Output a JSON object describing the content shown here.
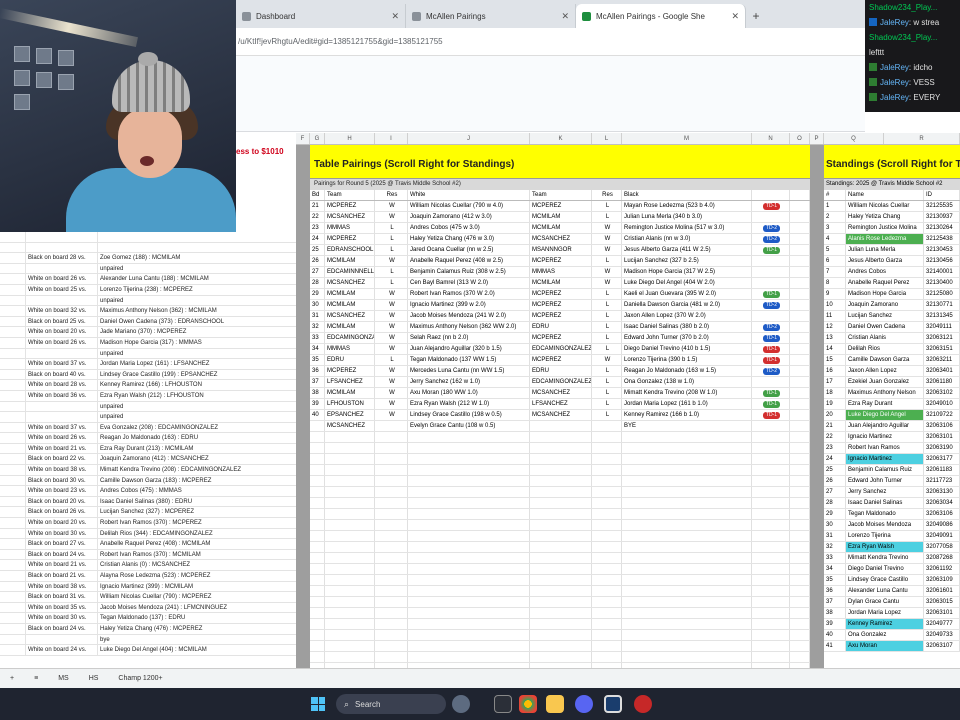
{
  "browser": {
    "tabs": [
      {
        "title": "Dashboard",
        "active": false
      },
      {
        "title": "McAllen Pairings",
        "active": false
      },
      {
        "title": "McAllen Pairings - Google She",
        "active": true
      }
    ],
    "url": "/u/KtIf!jevRhgtuA/edit#gid=1385121755&gid=1385121755"
  },
  "sheet": {
    "red_title": "ess to $1010",
    "column_headers": [
      "F",
      "G",
      "H",
      "I",
      "J",
      "K",
      "L",
      "M",
      "N",
      "O",
      "P",
      "Q",
      "R"
    ],
    "pairings": {
      "title": "Table Pairings (Scroll Right for Standings)",
      "subtitle": "Pairings for Round 5 (2025 @ Travis Middle School #2)",
      "headers": {
        "bd": "Bd",
        "team1": "Team",
        "res1": "Res",
        "white": "White",
        "team2": "Team",
        "res2": "Res",
        "black": "Black"
      },
      "rows": [
        {
          "bd": "21",
          "team1": "MCPEREZ",
          "res1": "W",
          "white": "William Nicolas Cuellar (790 w 4.0)",
          "team2": "MCPEREZ",
          "res2": "L",
          "black": "Mayan Rose Ledezma (523 b 4.0)",
          "tag": "TD-1",
          "tag_color": "red"
        },
        {
          "bd": "22",
          "team1": "MCSANCHEZ",
          "res1": "W",
          "white": "Joaquin Zamorano (412 w 3.0)",
          "team2": "MCMILAM",
          "res2": "L",
          "black": "Julian Luna Merla (340 b 3.0)",
          "tag": "",
          "tag_color": ""
        },
        {
          "bd": "23",
          "team1": "MMMAS",
          "res1": "L",
          "white": "Andres Cobos (475 w 3.0)",
          "team2": "MCMILAM",
          "res2": "W",
          "black": "Remington Justice Molina (517 w 3.0)",
          "tag": "TD-2",
          "tag_color": "blue"
        },
        {
          "bd": "24",
          "team1": "MCPEREZ",
          "res1": "L",
          "white": "Haley Yetiza Chang (476 w 3.0)",
          "team2": "MCSANCHEZ",
          "res2": "W",
          "black": "Cristian Alanis (nn w 3.0)",
          "tag": "TD-2",
          "tag_color": "blue"
        },
        {
          "bd": "25",
          "team1": "EDRANSCHOOL",
          "res1": "L",
          "white": "Jared Ocana Cuellar (nn w 2.5)",
          "team2": "MSANNNGOR",
          "res2": "W",
          "black": "Jesus Alberto Garza (411 W 2.5)",
          "tag": "TD-1",
          "tag_color": "green"
        },
        {
          "bd": "26",
          "team1": "MCMILAM",
          "res1": "W",
          "white": "Anabelle Raquel Perez (408 w 2.5)",
          "team2": "MCPEREZ",
          "res2": "L",
          "black": "Lucijan Sanchez (327 b 2.5)",
          "tag": "",
          "tag_color": ""
        },
        {
          "bd": "27",
          "team1": "EDCAMINNNELL",
          "res1": "L",
          "white": "Benjamin Calamus Ruiz (308 w 2.5)",
          "team2": "MMMAS",
          "res2": "W",
          "black": "Madison Hope Garcia (317 W 2.5)",
          "tag": "",
          "tag_color": ""
        },
        {
          "bd": "28",
          "team1": "MCSANCHEZ",
          "res1": "L",
          "white": "Cen Bayl Bamrel (313 W 2.0)",
          "team2": "MCMILAM",
          "res2": "W",
          "black": "Luke Diego Del Angel (404 W 2.0)",
          "tag": "",
          "tag_color": ""
        },
        {
          "bd": "29",
          "team1": "MCMILAM",
          "res1": "W",
          "white": "Robert Ivan Ramos (370 W 2.0)",
          "team2": "MCPEREZ",
          "res2": "L",
          "black": "Kaeli el Juan Guevara (395 W 2.0)",
          "tag": "TD-1",
          "tag_color": "green"
        },
        {
          "bd": "30",
          "team1": "MCMILAM",
          "res1": "W",
          "white": "Ignacio Martinez (399 w 2.0)",
          "team2": "MCPEREZ",
          "res2": "L",
          "black": "Daniella Dawson Garcia (481 w 2.0)",
          "tag": "TD-2",
          "tag_color": "blue"
        },
        {
          "bd": "31",
          "team1": "MCSANCHEZ",
          "res1": "W",
          "white": "Jacob Moises Mendoza (241 W 2.0)",
          "team2": "MCPEREZ",
          "res2": "L",
          "black": "Jaxon Allen Lopez (370 W 2.0)",
          "tag": "",
          "tag_color": ""
        },
        {
          "bd": "32",
          "team1": "MCMILAM",
          "res1": "W",
          "white": "Maximus Anthony Nelson (362 WW 2.0)",
          "team2": "EDRU",
          "res2": "L",
          "black": "Isaac Daniel Salinas (380 b 2.0)",
          "tag": "TD-2",
          "tag_color": "blue"
        },
        {
          "bd": "33",
          "team1": "EDCAMINGONZALEZ",
          "res1": "W",
          "white": "Selah Raez (nn b 2.0)",
          "team2": "MCPEREZ",
          "res2": "L",
          "black": "Edward John Turner (370 b 2.0)",
          "tag": "TD-1",
          "tag_color": "blue"
        },
        {
          "bd": "34",
          "team1": "MMMAS",
          "res1": "W",
          "white": "Juan Alejandro Aguillar (320 b 1.5)",
          "team2": "EDCAMINGONZALEZ",
          "res2": "L",
          "black": "Diego Daniel Trevino (410 b 1.5)",
          "tag": "TD-1",
          "tag_color": "red"
        },
        {
          "bd": "35",
          "team1": "EDRU",
          "res1": "L",
          "white": "Tegan Maldonado (137 WW 1.5)",
          "team2": "MCPEREZ",
          "res2": "W",
          "black": "Lorenzo Tijerina (390 b 1.5)",
          "tag": "TD-1",
          "tag_color": "red"
        },
        {
          "bd": "36",
          "team1": "MCPEREZ",
          "res1": "W",
          "white": "Mercedes Luna Cantu (nn WW 1.5)",
          "team2": "EDRU",
          "res2": "L",
          "black": "Reagan Jo Maldonado (163 w 1.5)",
          "tag": "TD-2",
          "tag_color": "blue"
        },
        {
          "bd": "37",
          "team1": "LFSANCHEZ",
          "res1": "W",
          "white": "Jerry Sanchez (162 w 1.0)",
          "team2": "EDCAMINGONZALEZ",
          "res2": "L",
          "black": "Ona Gonzalez (138 w 1.0)",
          "tag": "",
          "tag_color": ""
        },
        {
          "bd": "38",
          "team1": "MCMILAM",
          "res1": "W",
          "white": "Axu Moran (180 WW 1.0)",
          "team2": "MCSANCHEZ",
          "res2": "L",
          "black": "Mimatt Kendra Trevino (208 W 1.0)",
          "tag": "TD-1",
          "tag_color": "green"
        },
        {
          "bd": "39",
          "team1": "LFHOUSTON",
          "res1": "W",
          "white": "Ezra Ryan Walsh (212 W 1.0)",
          "team2": "LFSANCHEZ",
          "res2": "L",
          "black": "Jordan Maria Lopez (161 b 1.0)",
          "tag": "TD-1",
          "tag_color": "green"
        },
        {
          "bd": "40",
          "team1": "EPSANCHEZ",
          "res1": "W",
          "white": "Lindsey Grace Castillo (198 w 0.5)",
          "team2": "MCSANCHEZ",
          "res2": "L",
          "black": "Kenney Ramirez (166 b 1.0)",
          "tag": "TD-1",
          "tag_color": "red"
        },
        {
          "bd": "",
          "team1": "MCSANCHEZ",
          "res1": "",
          "white": "Evelyn Grace Cantu (108 w 0.5)",
          "team2": "",
          "res2": "",
          "black": "BYE",
          "tag": "",
          "tag_color": ""
        }
      ]
    },
    "standings": {
      "title": "Standings (Scroll Right for Team",
      "subtitle": "Standings: 2025 @ Travis Middle School #2",
      "headers": {
        "rank": "#",
        "name": "Name",
        "id": "ID"
      },
      "rows": [
        {
          "rank": "1",
          "name": "William Nicolas Cuellar",
          "id": "32125535",
          "hl": ""
        },
        {
          "rank": "2",
          "name": "Haley Yetiza Chang",
          "id": "32130937",
          "hl": ""
        },
        {
          "rank": "3",
          "name": "Remington Justice Molina",
          "id": "32130264",
          "hl": ""
        },
        {
          "rank": "4",
          "name": "Alanis Rose Ledezma",
          "id": "32125438",
          "hl": "green"
        },
        {
          "rank": "5",
          "name": "Julian Luna Merla",
          "id": "32130453",
          "hl": ""
        },
        {
          "rank": "6",
          "name": "Jesus Alberto Garza",
          "id": "32130456",
          "hl": ""
        },
        {
          "rank": "7",
          "name": "Andres Cobos",
          "id": "32140001",
          "hl": ""
        },
        {
          "rank": "8",
          "name": "Anabelle Raquel Perez",
          "id": "32130400",
          "hl": ""
        },
        {
          "rank": "9",
          "name": "Madison Hope Garcia",
          "id": "32125080",
          "hl": ""
        },
        {
          "rank": "10",
          "name": "Joaquin Zamorano",
          "id": "32130771",
          "hl": ""
        },
        {
          "rank": "11",
          "name": "Lucijan Sanchez",
          "id": "32131345",
          "hl": ""
        },
        {
          "rank": "12",
          "name": "Daniel Owen Cadena",
          "id": "32049111",
          "hl": ""
        },
        {
          "rank": "13",
          "name": "Cristian Alanis",
          "id": "32063121",
          "hl": ""
        },
        {
          "rank": "14",
          "name": "Delilah Rios",
          "id": "32063151",
          "hl": ""
        },
        {
          "rank": "15",
          "name": "Camille Dawson Garza",
          "id": "32063211",
          "hl": ""
        },
        {
          "rank": "16",
          "name": "Jaxon Allen Lopez",
          "id": "32063401",
          "hl": ""
        },
        {
          "rank": "17",
          "name": "Ezekiel Juan Gonzalez",
          "id": "32061180",
          "hl": ""
        },
        {
          "rank": "18",
          "name": "Maximus Anthony Nelson",
          "id": "32063102",
          "hl": ""
        },
        {
          "rank": "19",
          "name": "Ezra Ray Durant",
          "id": "32049010",
          "hl": ""
        },
        {
          "rank": "20",
          "name": "Luke Diego Del Angel",
          "id": "32109722",
          "hl": "green"
        },
        {
          "rank": "21",
          "name": "Juan Alejandro Aguillar",
          "id": "32063106",
          "hl": ""
        },
        {
          "rank": "22",
          "name": "Ignacio Martinez",
          "id": "32063101",
          "hl": ""
        },
        {
          "rank": "23",
          "name": "Robert Ivan Ramos",
          "id": "32063190",
          "hl": ""
        },
        {
          "rank": "24",
          "name": "Ignacio Martinez",
          "id": "32063177",
          "hl": "cyan"
        },
        {
          "rank": "25",
          "name": "Benjamin Calamus Ruiz",
          "id": "32061183",
          "hl": ""
        },
        {
          "rank": "26",
          "name": "Edward John Turner",
          "id": "32117723",
          "hl": ""
        },
        {
          "rank": "27",
          "name": "Jerry Sanchez",
          "id": "32063130",
          "hl": ""
        },
        {
          "rank": "28",
          "name": "Isaac Daniel Salinas",
          "id": "32063034",
          "hl": ""
        },
        {
          "rank": "29",
          "name": "Tegan Maldonado",
          "id": "32063106",
          "hl": ""
        },
        {
          "rank": "30",
          "name": "Jacob Moises Mendoza",
          "id": "32049086",
          "hl": ""
        },
        {
          "rank": "31",
          "name": "Lorenzo Tijerina",
          "id": "32049091",
          "hl": ""
        },
        {
          "rank": "32",
          "name": "Ezra Ryan Walsh",
          "id": "32077058",
          "hl": "cyan"
        },
        {
          "rank": "33",
          "name": "Mimatt Kendra Trevino",
          "id": "32087268",
          "hl": ""
        },
        {
          "rank": "34",
          "name": "Diego Daniel Trevino",
          "id": "32061192",
          "hl": ""
        },
        {
          "rank": "35",
          "name": "Lindsey Grace Castillo",
          "id": "32063109",
          "hl": ""
        },
        {
          "rank": "36",
          "name": "Alexander Luna Cantu",
          "id": "32061601",
          "hl": ""
        },
        {
          "rank": "37",
          "name": "Dylan Grace Cantu",
          "id": "32063015",
          "hl": ""
        },
        {
          "rank": "38",
          "name": "Jordan Maria Lopez",
          "id": "32063101",
          "hl": ""
        },
        {
          "rank": "39",
          "name": "Kenney Ramirez",
          "id": "32049777",
          "hl": "cyan"
        },
        {
          "rank": "40",
          "name": "Ona Gonzalez",
          "id": "32049733",
          "hl": ""
        },
        {
          "rank": "41",
          "name": "Axu Moran",
          "id": "32063107",
          "hl": "cyan"
        }
      ]
    },
    "left_rows": [
      {
        "c0": "",
        "c1": "",
        "c2": ""
      },
      {
        "c0": "",
        "c1": "",
        "c2": ""
      },
      {
        "c0": "",
        "c1": "Black on board 28 vs.",
        "c2": "Zoe Gomez (188) : MCMILAM"
      },
      {
        "c0": "",
        "c1": "",
        "c2": "unpaired"
      },
      {
        "c0": "",
        "c1": "White on board 26 vs.",
        "c2": "Alexander Luna Cantu (188) : MCMILAM"
      },
      {
        "c0": "",
        "c1": "White on board 25 vs.",
        "c2": "Lorenzo Tijerina (238) : MCPEREZ"
      },
      {
        "c0": "",
        "c1": "",
        "c2": "unpaired"
      },
      {
        "c0": "",
        "c1": "White on board 32 vs.",
        "c2": "Maximus Anthony Nelson (362) : MCMILAM"
      },
      {
        "c0": "",
        "c1": "Black on board 25 vs.",
        "c2": "Daniel Owen Cadena (373) : EDRANSCHOOL"
      },
      {
        "c0": "",
        "c1": "White on board 20 vs.",
        "c2": "Jade Mariano (370) : MCPEREZ"
      },
      {
        "c0": "",
        "c1": "White on board 26 vs.",
        "c2": "Madison Hope Garcia (317) : MMMAS"
      },
      {
        "c0": "",
        "c1": "",
        "c2": "unpaired"
      },
      {
        "c0": "",
        "c1": "White on board 37 vs.",
        "c2": "Jordan Maria Lopez (161) : LFSANCHEZ"
      },
      {
        "c0": "",
        "c1": "Black on board 40 vs.",
        "c2": "Lindsey Grace Castillo (199) : EPSANCHEZ"
      },
      {
        "c0": "",
        "c1": "White on board 28 vs.",
        "c2": "Kenney Ramirez (166) : LFHOUSTON"
      },
      {
        "c0": "",
        "c1": "White on board 36 vs.",
        "c2": "Ezra Ryan Walsh (212) : LFHOUSTON"
      },
      {
        "c0": "",
        "c1": "",
        "c2": "unpaired"
      },
      {
        "c0": "",
        "c1": "",
        "c2": "unpaired"
      },
      {
        "c0": "",
        "c1": "White on board 37 vs.",
        "c2": "Eva Gonzalez (208) : EDCAMINGONZALEZ"
      },
      {
        "c0": "",
        "c1": "White on board 26 vs.",
        "c2": "Reagan Jo Maldonado (163) : EDRU"
      },
      {
        "c0": "",
        "c1": "White on board 21 vs.",
        "c2": "Ezra Ray Durant (213) : MCMILAM"
      },
      {
        "c0": "",
        "c1": "Black on board 22 vs.",
        "c2": "Joaquin Zamorano (412) : MCSANCHEZ"
      },
      {
        "c0": "",
        "c1": "White on board 38 vs.",
        "c2": "Mimatt Kendra Trevino (208) : EDCAMINGONZALEZ"
      },
      {
        "c0": "",
        "c1": "Black on board 30 vs.",
        "c2": "Camille Dawson Garza (183) : MCPEREZ"
      },
      {
        "c0": "",
        "c1": "White on board 23 vs.",
        "c2": "Andres Cobos (475) : MMMAS"
      },
      {
        "c0": "",
        "c1": "Black on board 20 vs.",
        "c2": "Isaac Daniel Salinas (380) : EDRU"
      },
      {
        "c0": "",
        "c1": "Black on board 26 vs.",
        "c2": "Lucijan Sanchez (327) : MCPEREZ"
      },
      {
        "c0": "",
        "c1": "White on board 20 vs.",
        "c2": "Robert Ivan Ramos (370) : MCPEREZ"
      },
      {
        "c0": "",
        "c1": "White on board 30 vs.",
        "c2": "Delilah Rios (344) : EDCAMINGONZALEZ"
      },
      {
        "c0": "",
        "c1": "Black on board 27 vs.",
        "c2": "Anabelle Raquel Perez (408) : MCMILAM"
      },
      {
        "c0": "",
        "c1": "Black on board 24 vs.",
        "c2": "Robert Ivan Ramos (370) : MCMILAM"
      },
      {
        "c0": "",
        "c1": "White on board 21 vs.",
        "c2": "Cristian Alanis (0) : MCSANCHEZ"
      },
      {
        "c0": "",
        "c1": "Black on board 21 vs.",
        "c2": "Alayna Rose Ledezma (523) : MCPEREZ"
      },
      {
        "c0": "",
        "c1": "White on board 38 vs.",
        "c2": "Ignacio Martinez (399) : MCMILAM"
      },
      {
        "c0": "",
        "c1": "Black on board 31 vs.",
        "c2": "William Nicolas Cuellar (790) : MCPEREZ"
      },
      {
        "c0": "",
        "c1": "White on board 35 vs.",
        "c2": "Jacob Moises Mendoza (241) : LFMCNINGUEZ"
      },
      {
        "c0": "",
        "c1": "White on board 30 vs.",
        "c2": "Tegan Maldonado (137) : EDRU"
      },
      {
        "c0": "",
        "c1": "Black on board 24 vs.",
        "c2": "Haley Yetiza Chang (476) : MCPEREZ"
      },
      {
        "c0": "",
        "c1": "",
        "c2": "bye"
      },
      {
        "c0": "",
        "c1": "White on board 24 vs.",
        "c2": "Luke Diego Del Angel (404) : MCMILAM"
      }
    ],
    "sheet_tabs": [
      "MS",
      "HS",
      "Champ 1200+"
    ]
  },
  "chat": {
    "messages": [
      {
        "user": "Shadow234_Play...",
        "text": "",
        "badge": "",
        "user_color": "green"
      },
      {
        "user": "JaleRey",
        "text": ": w strea",
        "badge": "blue",
        "user_color": "blue"
      },
      {
        "user": "Shadow234_Play...",
        "text": "",
        "badge": "",
        "user_color": "green"
      },
      {
        "user": "",
        "text": "lefttt",
        "badge": "",
        "user_color": ""
      },
      {
        "user": "JaleRey",
        "text": ": idcho",
        "badge": "green",
        "user_color": "blue"
      },
      {
        "user": "JaleRey",
        "text": ": VESS",
        "badge": "green",
        "user_color": "blue"
      },
      {
        "user": "JaleRey",
        "text": ": EVERY",
        "badge": "green",
        "user_color": "blue"
      }
    ]
  },
  "taskbar": {
    "search_label": "Search"
  },
  "colors": {
    "header_yellow": "#ffff00",
    "freeze_gray": "#9e9e9e",
    "tag_red": "#d32f2f",
    "tag_blue": "#1e5bc6",
    "tag_green": "#43a047",
    "highlight_green": "#4caf50",
    "highlight_cyan": "#4dd0e1"
  }
}
